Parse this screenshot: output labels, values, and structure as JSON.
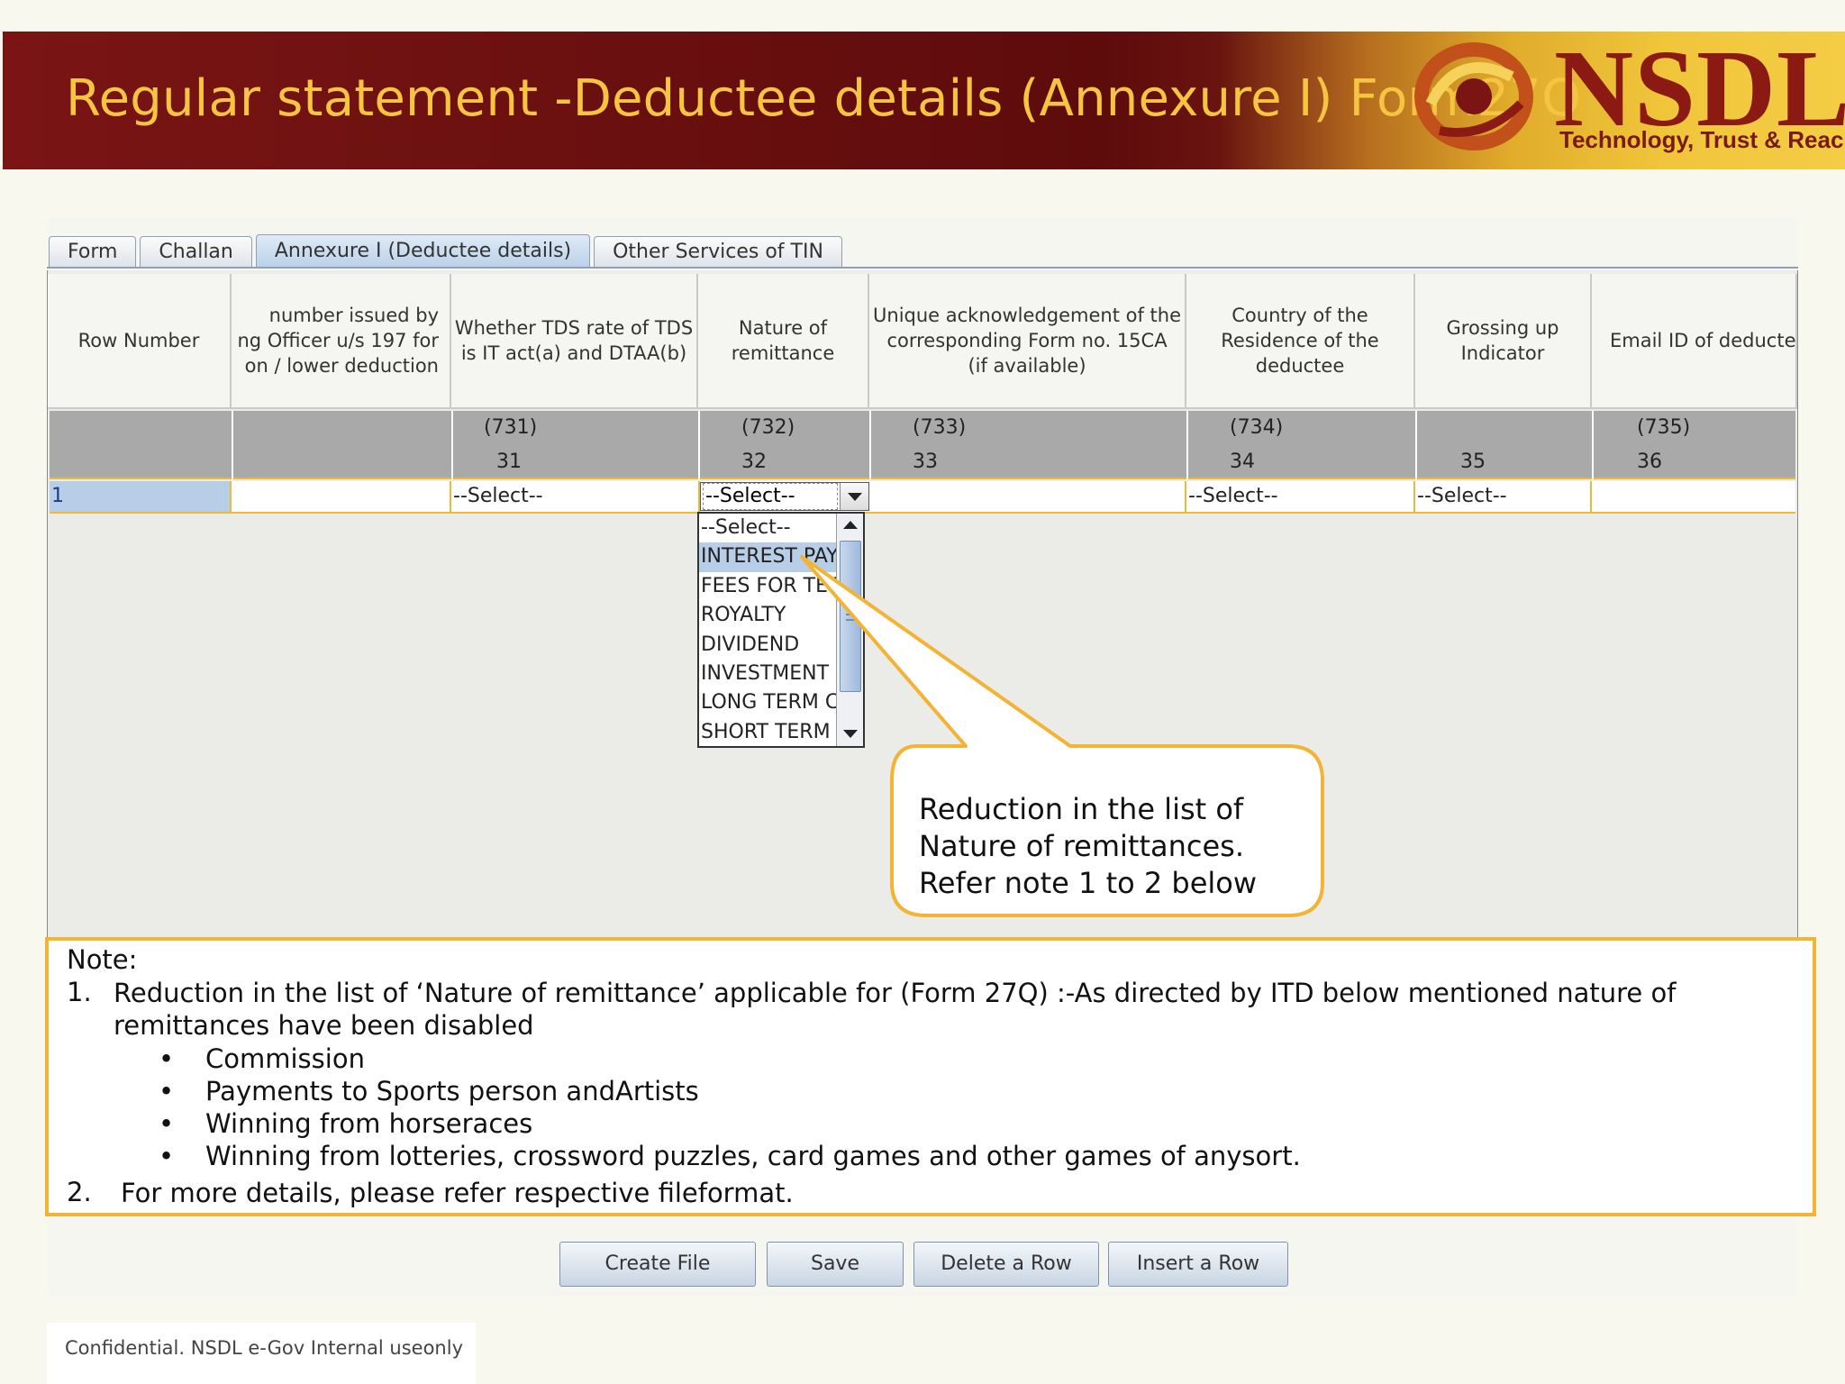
{
  "slide": {
    "title": "Regular statement -Deductee details (Annexure I) Form27Q",
    "brand": {
      "name": "NSDL",
      "tagline": "Technology, Trust & Reach"
    },
    "footer": "Confidential. NSDL e-Gov Internal useonly"
  },
  "tabs": [
    {
      "label": "Form",
      "active": false
    },
    {
      "label": "Challan",
      "active": false
    },
    {
      "label": "Annexure I (Deductee details)",
      "active": true
    },
    {
      "label": "Other Services of TIN",
      "active": false
    }
  ],
  "table": {
    "headers": [
      "Row Number",
      "number issued by\nng Officer u/s 197 for\non / lower deduction",
      "Whether TDS rate of TDS\nis IT act(a) and DTAA(b)",
      "Nature of\nremittance",
      "Unique acknowledgement of the\ncorresponding Form no. 15CA\n(if available)",
      "Country of the\nResidence of the\ndeductee",
      "Grossing up\nIndicator",
      "Email ID of deductee"
    ],
    "codes": [
      "",
      "",
      "(731)",
      "(732)",
      "(733)",
      "(734)",
      "",
      "(735)"
    ],
    "numbers": [
      "",
      "",
      "31",
      "32",
      "33",
      "34",
      "35",
      "36"
    ],
    "row": {
      "row_number": "1",
      "tds_rate_select": "--Select--",
      "nature_select": "--Select--",
      "country_select": "--Select--",
      "grossing_select": "--Select--"
    }
  },
  "dropdown": {
    "items": [
      "--Select--",
      "INTEREST PAYMENT",
      "FEES FOR TECHNICAL SERVICES",
      "ROYALTY",
      "DIVIDEND",
      "INVESTMENT",
      "LONG TERM CAPITAL GAIN",
      "SHORT TERM CAPITAL GAIN"
    ],
    "selected_index": 1
  },
  "callout": {
    "lines": [
      "Reduction in the list of",
      "Nature of remittances.",
      "Refer note 1 to 2 below"
    ]
  },
  "note": {
    "title": "Note:",
    "item1_num": "1.",
    "item1_text": "Reduction in the list of ‘Nature of remittance’ applicable for (Form 27Q) :-As directed by ITD below mentioned nature of remittances have been disabled",
    "bullets": [
      "Commission",
      "Payments to Sports person andArtists",
      "Winning from horseraces",
      "Winning from lotteries, crossword puzzles, card games and other games of anysort."
    ],
    "item2_num": "2.",
    "item2_text": "For more details, please refer respective fileformat."
  },
  "buttons": {
    "create_file": "Create File",
    "save": "Save",
    "delete_row": "Delete a Row",
    "insert_row": "Insert a Row"
  },
  "colors": {
    "banner_dark": "#5e0b0c",
    "title_gold": "#f5c542",
    "accent_border": "#f3b334",
    "selection_blue": "#b8cde6"
  }
}
